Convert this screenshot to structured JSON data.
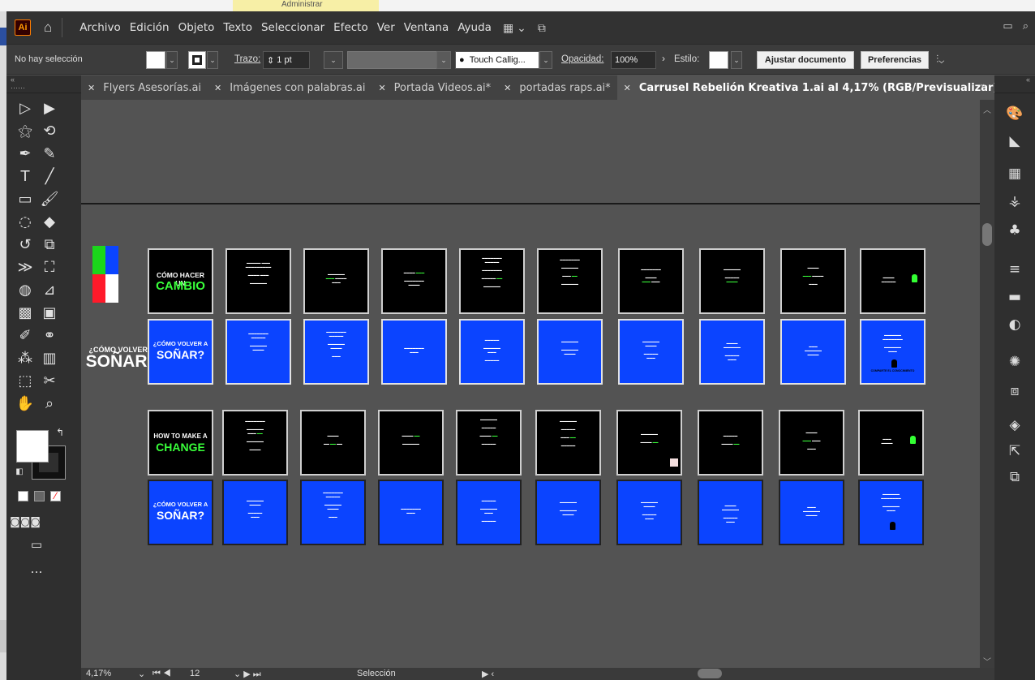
{
  "behind": {
    "yellow_tab": "Administrar"
  },
  "menubar": {
    "logo": "Ai",
    "items": [
      "Archivo",
      "Edición",
      "Objeto",
      "Texto",
      "Seleccionar",
      "Efecto",
      "Ver",
      "Ventana",
      "Ayuda"
    ]
  },
  "controlbar": {
    "selection": "No hay selección",
    "stroke_label": "Trazo:",
    "stroke_value": "1 pt",
    "brush": "Touch Callig...",
    "opacity_label": "Opacidad:",
    "opacity_value": "100%",
    "style_label": "Estilo:",
    "doc_button": "Ajustar documento",
    "prefs_button": "Preferencias"
  },
  "tabs": [
    {
      "label": "Flyers Asesorías.ai"
    },
    {
      "label": "Imágenes con palabras.ai"
    },
    {
      "label": "Portada Videos.ai*"
    },
    {
      "label": "portadas raps.ai*"
    },
    {
      "label": "Carrusel Rebelión Kreativa 1.ai al 4,17% (RGB/Previsualizar)"
    }
  ],
  "artboards": {
    "side_label_small": "¿CÓMO VOLVER A",
    "side_label_big": "SOÑAR?",
    "row1_cover": {
      "line1": "CÓMO HACER UN",
      "line2": "CAMBIO"
    },
    "row2_cover": {
      "line1": "HOW TO MAKE A",
      "line2": "CHANGE"
    },
    "blue_cover_es": {
      "line1": "¿CÓMO VOLVER A",
      "line2": "SOÑAR?"
    },
    "blue_cover_es2": {
      "line1": "¿CÓMO VOLVER A",
      "line2": "SOÑAR?"
    },
    "final_slide": "COMPARTE EL CONOCIMIENTO"
  },
  "statusbar": {
    "zoom": "4,17%",
    "page": "12",
    "tool": "Selección"
  },
  "colors": {
    "accent_blue": "#0b44ff",
    "accent_green": "#39ff3a",
    "ui_dark": "#323232"
  }
}
